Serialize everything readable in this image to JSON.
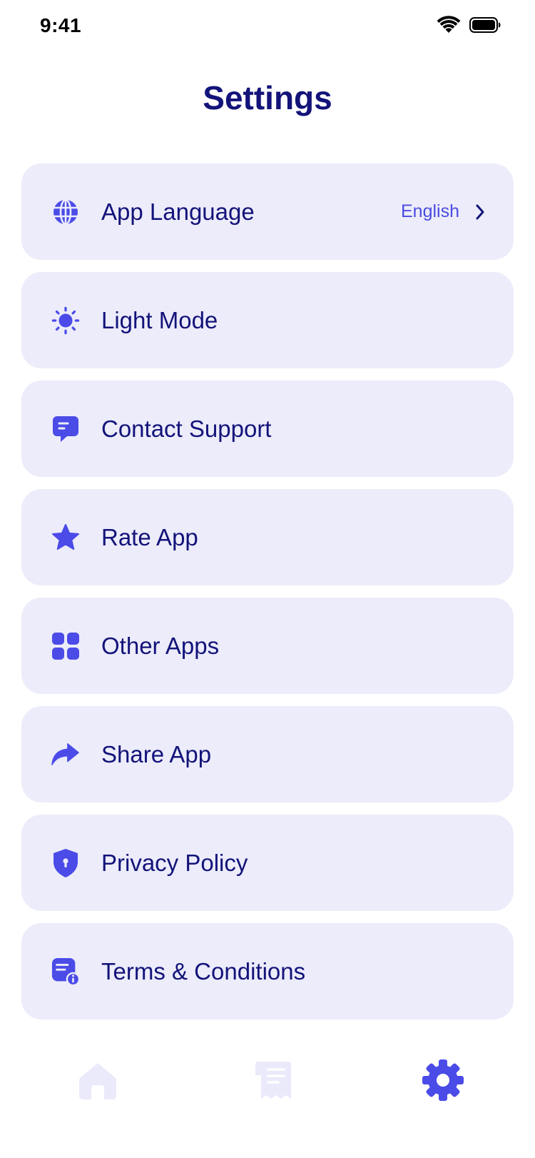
{
  "status_bar": {
    "time": "9:41",
    "wifi_icon": "wifi-icon",
    "battery_icon": "battery-icon"
  },
  "page": {
    "title": "Settings"
  },
  "colors": {
    "accent": "#4b4be8",
    "card_bg": "#ececfb",
    "text_primary": "#13137a",
    "tab_inactive": "#eaeafb"
  },
  "settings": {
    "items": [
      {
        "label": "App Language",
        "icon": "globe-icon",
        "value": "English",
        "has_chevron": true
      },
      {
        "label": "Light Mode",
        "icon": "sun-icon"
      },
      {
        "label": "Contact Support",
        "icon": "chat-icon"
      },
      {
        "label": "Rate App",
        "icon": "star-icon"
      },
      {
        "label": "Other Apps",
        "icon": "grid-icon"
      },
      {
        "label": "Share App",
        "icon": "share-icon"
      },
      {
        "label": "Privacy Policy",
        "icon": "shield-icon"
      },
      {
        "label": "Terms & Conditions",
        "icon": "document-info-icon"
      }
    ]
  },
  "tab_bar": {
    "tabs": [
      {
        "icon": "home-icon",
        "active": false
      },
      {
        "icon": "receipt-icon",
        "active": false
      },
      {
        "icon": "gear-icon",
        "active": true
      }
    ]
  }
}
